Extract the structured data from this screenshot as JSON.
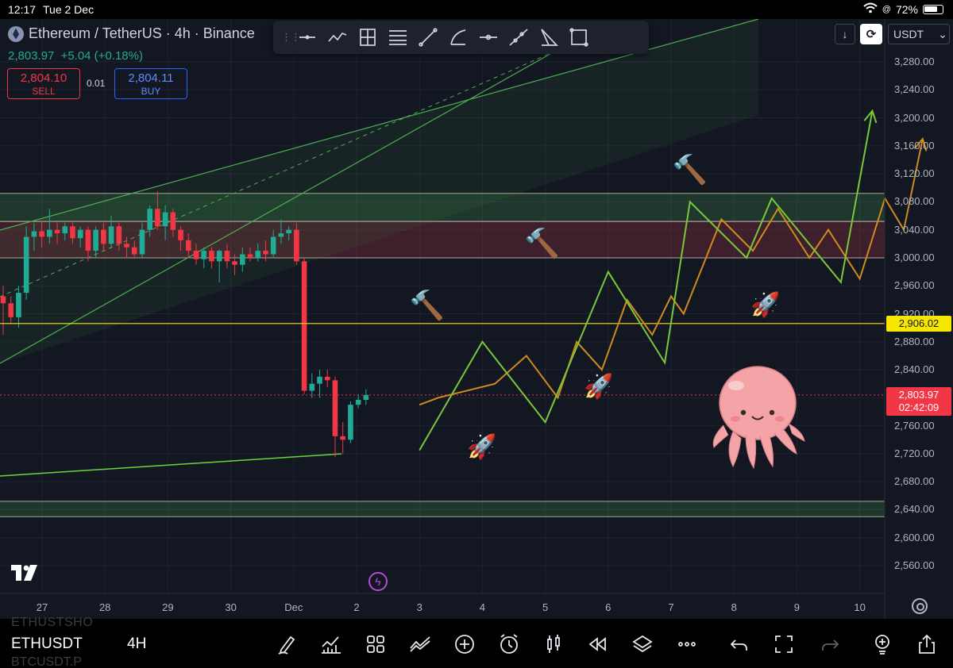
{
  "status_bar": {
    "time": "12:17",
    "date": "Tue 2 Dec",
    "battery": "72%"
  },
  "symbol": {
    "title": "Ethereum / TetherUS · 4h · Binance",
    "last_price": "2,803.97",
    "change": "+5.04 (+0.18%)"
  },
  "trade": {
    "sell_price": "2,804.10",
    "sell_label": "SELL",
    "spread": "0.01",
    "buy_price": "2,804.11",
    "buy_label": "BUY"
  },
  "drawing_toolbar": {
    "tools": [
      "horizontal-line",
      "path",
      "long-short-position",
      "parallel-channel",
      "trend-line",
      "arc",
      "horizontal-ray",
      "extended-line",
      "triangle-pattern",
      "rectangle"
    ]
  },
  "top_right": {
    "currency": "USDT",
    "currency_chevron": "⌄"
  },
  "price_axis": {
    "ticks": [
      "3,280.00",
      "3,240.00",
      "3,200.00",
      "3,160.00",
      "3,120.00",
      "3,080.00",
      "3,040.00",
      "3,000.00",
      "2,960.00",
      "2,920.00",
      "2,880.00",
      "2,840.00",
      "2,760.00",
      "2,720.00",
      "2,680.00",
      "2,640.00",
      "2,600.00",
      "2,560.00"
    ],
    "yellow_level_label": "2,906.02",
    "current_price_label": "2,803.97",
    "countdown": "02:42:09"
  },
  "time_axis": {
    "ticks": [
      "27",
      "28",
      "29",
      "30",
      "Dec",
      "2",
      "3",
      "4",
      "5",
      "6",
      "7",
      "8",
      "9",
      "10"
    ]
  },
  "bottom_bar": {
    "ticker": "ETHUSDT",
    "interval": "4H",
    "ghost_ticker_top": "ETHUSTSHO",
    "ghost_ticker_bottom": "BTCUSDT.P",
    "icons": [
      "pen-icon",
      "indicators-icon",
      "layout-grid-icon",
      "compare-icon",
      "add-icon",
      "alert-icon",
      "candles-icon",
      "replay-icon",
      "layers-icon",
      "more-icon",
      "undo-icon",
      "fullscreen-icon",
      "redo-icon",
      "ideas-icon",
      "share-icon"
    ]
  },
  "colors": {
    "background": "#131722",
    "up": "#22ab94",
    "down": "#f23645",
    "accent_green": "#4caf50",
    "level_yellow": "#f7e600",
    "projection_orange": "#d08a1e"
  },
  "chart_data": {
    "type": "candlestick",
    "symbol": "ETHUSDT",
    "interval": "4h",
    "ylim": [
      2540,
      3310
    ],
    "x_ticks": [
      "27",
      "28",
      "29",
      "30",
      "Dec",
      "2",
      "3",
      "4",
      "5",
      "6",
      "7",
      "8",
      "9",
      "10"
    ],
    "candles": [
      {
        "o": 2945,
        "h": 2960,
        "l": 2890,
        "c": 2935
      },
      {
        "o": 2935,
        "h": 2945,
        "l": 2905,
        "c": 2915
      },
      {
        "o": 2915,
        "h": 2960,
        "l": 2900,
        "c": 2950
      },
      {
        "o": 2950,
        "h": 3045,
        "l": 2940,
        "c": 3030
      },
      {
        "o": 3030,
        "h": 3050,
        "l": 3010,
        "c": 3038
      },
      {
        "o": 3038,
        "h": 3052,
        "l": 3015,
        "c": 3030
      },
      {
        "o": 3030,
        "h": 3070,
        "l": 3020,
        "c": 3040
      },
      {
        "o": 3040,
        "h": 3050,
        "l": 3020,
        "c": 3035
      },
      {
        "o": 3035,
        "h": 3050,
        "l": 3025,
        "c": 3045
      },
      {
        "o": 3045,
        "h": 3050,
        "l": 3020,
        "c": 3028
      },
      {
        "o": 3028,
        "h": 3045,
        "l": 3015,
        "c": 3040
      },
      {
        "o": 3040,
        "h": 3045,
        "l": 2995,
        "c": 3010
      },
      {
        "o": 3010,
        "h": 3045,
        "l": 3000,
        "c": 3040
      },
      {
        "o": 3040,
        "h": 3050,
        "l": 3010,
        "c": 3020
      },
      {
        "o": 3020,
        "h": 3060,
        "l": 3015,
        "c": 3045
      },
      {
        "o": 3045,
        "h": 3050,
        "l": 3010,
        "c": 3020
      },
      {
        "o": 3020,
        "h": 3030,
        "l": 3000,
        "c": 3015
      },
      {
        "o": 3015,
        "h": 3025,
        "l": 3000,
        "c": 3005
      },
      {
        "o": 3005,
        "h": 3050,
        "l": 3000,
        "c": 3040
      },
      {
        "o": 3040,
        "h": 3075,
        "l": 3030,
        "c": 3070
      },
      {
        "o": 3070,
        "h": 3095,
        "l": 3040,
        "c": 3045
      },
      {
        "o": 3045,
        "h": 3075,
        "l": 3025,
        "c": 3065
      },
      {
        "o": 3065,
        "h": 3070,
        "l": 3030,
        "c": 3040
      },
      {
        "o": 3040,
        "h": 3045,
        "l": 3010,
        "c": 3025
      },
      {
        "o": 3025,
        "h": 3035,
        "l": 3000,
        "c": 3010
      },
      {
        "o": 3010,
        "h": 3020,
        "l": 2990,
        "c": 2998
      },
      {
        "o": 2998,
        "h": 3015,
        "l": 2985,
        "c": 3010
      },
      {
        "o": 3010,
        "h": 3015,
        "l": 2985,
        "c": 2995
      },
      {
        "o": 2995,
        "h": 3012,
        "l": 2965,
        "c": 3010
      },
      {
        "o": 3010,
        "h": 3020,
        "l": 2985,
        "c": 2995
      },
      {
        "o": 2995,
        "h": 3005,
        "l": 2975,
        "c": 2990
      },
      {
        "o": 2990,
        "h": 3015,
        "l": 2980,
        "c": 3005
      },
      {
        "o": 3005,
        "h": 3015,
        "l": 2995,
        "c": 3000
      },
      {
        "o": 3000,
        "h": 3020,
        "l": 2995,
        "c": 3010
      },
      {
        "o": 3010,
        "h": 3025,
        "l": 2995,
        "c": 3005
      },
      {
        "o": 3005,
        "h": 3040,
        "l": 3000,
        "c": 3030
      },
      {
        "o": 3030,
        "h": 3055,
        "l": 3020,
        "c": 3035
      },
      {
        "o": 3035,
        "h": 3045,
        "l": 3025,
        "c": 3040
      },
      {
        "o": 3040,
        "h": 3050,
        "l": 2990,
        "c": 2995
      },
      {
        "o": 2995,
        "h": 3000,
        "l": 2805,
        "c": 2810
      },
      {
        "o": 2810,
        "h": 2835,
        "l": 2800,
        "c": 2820
      },
      {
        "o": 2820,
        "h": 2840,
        "l": 2800,
        "c": 2830
      },
      {
        "o": 2830,
        "h": 2840,
        "l": 2815,
        "c": 2825
      },
      {
        "o": 2825,
        "h": 2830,
        "l": 2715,
        "c": 2745
      },
      {
        "o": 2745,
        "h": 2765,
        "l": 2720,
        "c": 2740
      },
      {
        "o": 2740,
        "h": 2795,
        "l": 2735,
        "c": 2790
      },
      {
        "o": 2790,
        "h": 2805,
        "l": 2785,
        "c": 2797
      },
      {
        "o": 2797,
        "h": 2812,
        "l": 2790,
        "c": 2804
      }
    ],
    "levels": {
      "yellow_line": 2906.02,
      "current_price": 2803.97,
      "resistance_zone_green": [
        3052,
        3092
      ],
      "resistance_zone_red": [
        3000,
        3052
      ],
      "support_zone_green": [
        2630,
        2652
      ]
    },
    "projections": {
      "green_path": [
        [
          2.0,
          2725
        ],
        [
          3.0,
          2880
        ],
        [
          4.0,
          2765
        ],
        [
          5.0,
          2980
        ],
        [
          5.9,
          2850
        ],
        [
          6.3,
          3080
        ],
        [
          7.2,
          3000
        ],
        [
          7.6,
          3085
        ],
        [
          8.7,
          2965
        ],
        [
          9.2,
          3210
        ]
      ],
      "orange_path": [
        [
          2.0,
          2790
        ],
        [
          2.3,
          2800
        ],
        [
          3.2,
          2820
        ],
        [
          3.7,
          2860
        ],
        [
          4.2,
          2800
        ],
        [
          4.5,
          2880
        ],
        [
          4.9,
          2840
        ],
        [
          5.3,
          2940
        ],
        [
          5.7,
          2890
        ],
        [
          6.0,
          2945
        ],
        [
          6.2,
          2920
        ],
        [
          6.8,
          3055
        ],
        [
          7.3,
          3010
        ],
        [
          7.7,
          3070
        ],
        [
          8.2,
          3000
        ],
        [
          8.5,
          3040
        ],
        [
          9.0,
          2970
        ],
        [
          9.4,
          3085
        ],
        [
          9.7,
          3040
        ],
        [
          10.0,
          3170
        ]
      ]
    }
  }
}
